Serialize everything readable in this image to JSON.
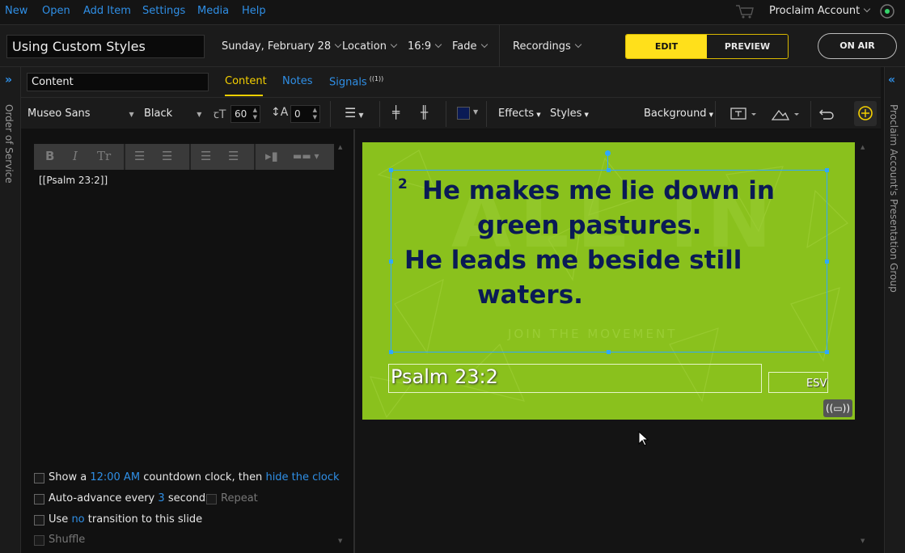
{
  "menu": {
    "items": [
      "New",
      "Open",
      "Add Item",
      "Settings",
      "Media",
      "Help"
    ],
    "account": "Proclaim Account"
  },
  "topbar": {
    "presentation_title": "Using Custom Styles",
    "date": "Sunday, February 28",
    "location": "Location",
    "aspect": "16:9",
    "transition": "Fade",
    "recordings": "Recordings",
    "edit": "EDIT",
    "preview": "PREVIEW",
    "on_air": "ON AIR"
  },
  "sidebars": {
    "left": "Order of Service",
    "right": "Proclaim Account's Presentation Group"
  },
  "tabs": {
    "slide_name": "Content",
    "items": [
      "Content",
      "Notes",
      "Signals"
    ],
    "signals_badge": "((1))"
  },
  "format": {
    "font": "Museo Sans",
    "weight": "Black",
    "size": "60",
    "spacing": "0",
    "effects": "Effects",
    "styles": "Styles",
    "background": "Background",
    "text_color": "#0a1a55"
  },
  "editor": {
    "content": "[[Psalm 23:2]]",
    "rte_b": "B",
    "rte_i": "I",
    "rte_tt": "Tr",
    "opt1_pre": "Show a",
    "opt1_time": "12:00 AM",
    "opt1_mid": "countdown clock, then",
    "opt1_link": "hide the clock",
    "opt2_pre": "Auto-advance every",
    "opt2_num": "3",
    "opt2_post": "seconds",
    "opt2_repeat": "Repeat",
    "opt3_pre": "Use",
    "opt3_no": "no",
    "opt3_post": "transition to this slide",
    "opt4": "Shuffle"
  },
  "slide": {
    "verse_number": "2",
    "line1": "He makes me lie down in",
    "line2": "green pastures.",
    "line3": "He leads me beside still",
    "line4": "waters.",
    "watermark": "ALL IN",
    "watermark_sub": "JOIN THE MOVEMENT",
    "reference": "Psalm 23:2",
    "version": "ESV",
    "bg_color": "#8ac11d",
    "text_color": "#0a1a55"
  },
  "colors": {
    "accent": "#2f8fe6",
    "edit_yellow": "#ffe01b",
    "active_tab": "#f5d000"
  }
}
